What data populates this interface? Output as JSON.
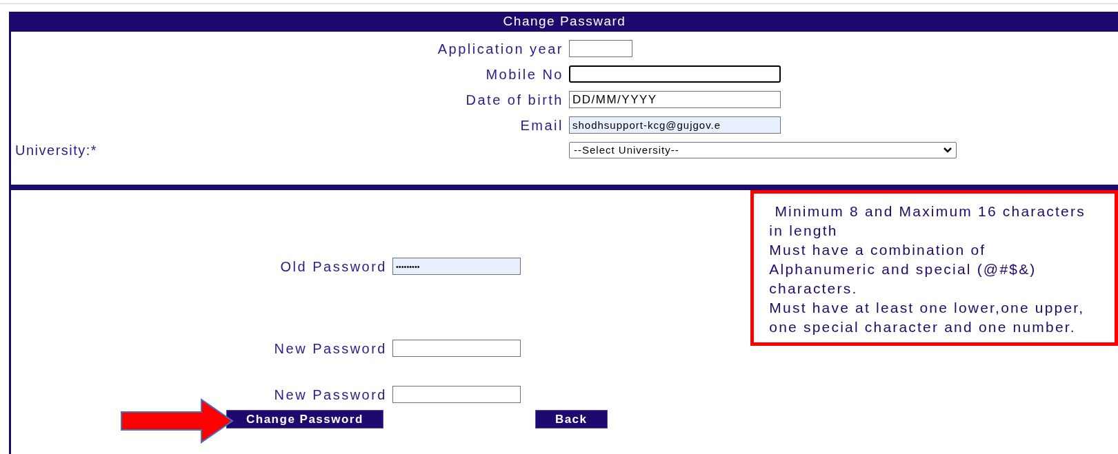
{
  "header": {
    "title": "Change Passward"
  },
  "fields": [
    {
      "label": "Application year",
      "kind": "short",
      "focused": false,
      "autofilled": false
    },
    {
      "label": "Mobile No",
      "kind": "long",
      "focused": true,
      "autofilled": false
    },
    {
      "label": "Date of birth",
      "value": "DD/MM/YYYY",
      "kind": "long",
      "focused": false,
      "autofilled": false
    },
    {
      "label": "Email",
      "value": "shodhsupport-kcg@gujgov.e",
      "kind": "long",
      "focused": false,
      "autofilled": true
    }
  ],
  "university": {
    "label": "University:*",
    "value": "--Select University--"
  },
  "password_fields": [
    {
      "label": "Old Password",
      "value": "•••••••••",
      "autofilled": true
    },
    {
      "label": "New Password",
      "autofilled": false
    },
    {
      "label": "New Password",
      "autofilled": false
    }
  ],
  "password_rules": [
    " Minimum 8 and Maximum 16 characters",
    "in length",
    "Must have a combination of",
    "Alphanumeric and special (@#$&)",
    "characters.",
    "Must have at least one lower,one upper,",
    "one special character and one number."
  ],
  "buttons": [
    {
      "label": "Change Password"
    },
    {
      "label": "Back"
    }
  ]
}
